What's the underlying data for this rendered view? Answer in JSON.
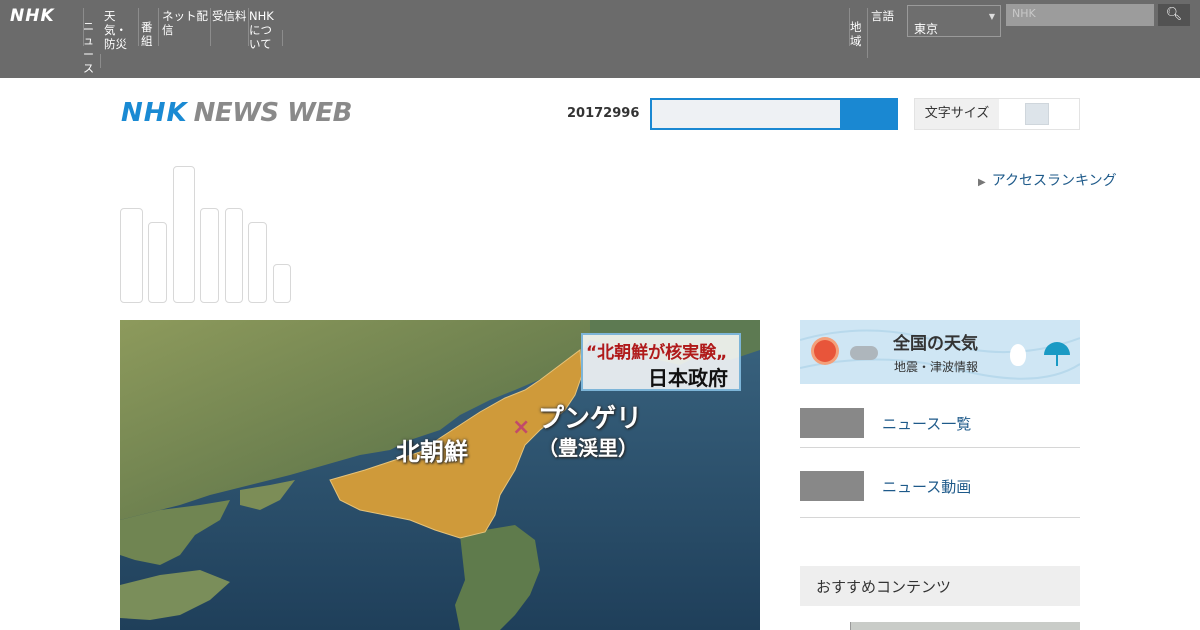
{
  "topbar": {
    "logo": "NHK",
    "nav": [
      "ニュース",
      "天気・防災",
      "番組",
      "ネット配信",
      "受信料",
      "NHKについて"
    ],
    "right_items": [
      "地域",
      "言語"
    ],
    "region_value": "東京",
    "search_placeholder": "NHK",
    "search_icon": "search-icon"
  },
  "header": {
    "logo_nhk": "NHK",
    "logo_news": "NEWS WEB",
    "date": "20172996",
    "toggle_label": "文字サイズ"
  },
  "ranking_link": "アクセスランキング",
  "hero": {
    "caption_title": "“北朝鮮が核実験„",
    "caption_source": "日本政府",
    "place_name": "プンゲリ",
    "place_kanji": "（豊渓里）",
    "country": "北朝鮮"
  },
  "sidebar": {
    "weather_title": "全国の天気",
    "weather_sub": "地震・津波情報",
    "items": [
      "ニュース一覧",
      "ニュース動画"
    ],
    "section_head": "おすすめコンテンツ"
  }
}
